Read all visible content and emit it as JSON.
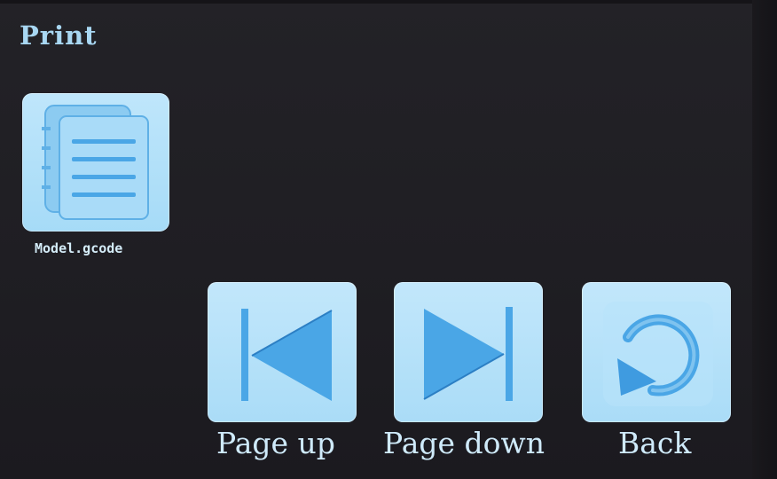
{
  "screen": {
    "title": "Print"
  },
  "files": [
    {
      "name": "Model.gcode",
      "icon": "document-stack-icon"
    }
  ],
  "navigation": {
    "page_up": {
      "label": "Page up",
      "icon": "skip-previous-icon"
    },
    "page_down": {
      "label": "Page down",
      "icon": "skip-next-icon"
    },
    "back": {
      "label": "Back",
      "icon": "return-arrow-icon"
    }
  },
  "colors": {
    "background": "#1f1e23",
    "tile": "#b4e0f8",
    "icon_blue": "#4aa6e6",
    "text": "#a8d7f2"
  }
}
